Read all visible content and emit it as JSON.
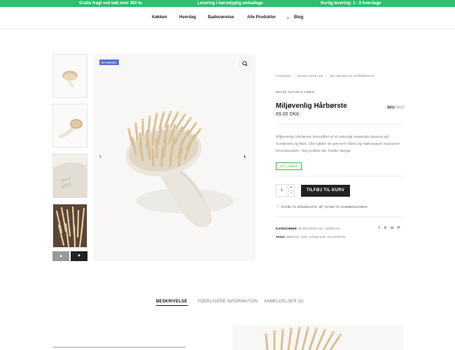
{
  "topbar": {
    "left": "Gratis fragt ved køb over 300 kr.",
    "center": "Levering i bæredygtig emballage",
    "right": "Hurtig levering: 1 - 3 hverdage"
  },
  "nav": {
    "items": [
      "Køkken",
      "Hverdag",
      "Badeværelse",
      "Alle Produkter",
      "Blog"
    ]
  },
  "product": {
    "badge": "NYHEDE!",
    "breadcrumb": [
      "FORSIDE",
      "BADEVÆRELSE",
      "MILJØVENLIG HÅRBØRSTE"
    ],
    "brand": "BETER NATURAL FIBER",
    "title": "Miljøvenlig Hårbørste",
    "sku_label": "SKU:",
    "sku_value": "5012",
    "price": "69,00 DKK",
    "description": "Miljøvenlig hårbørste fremstillet af et naturligt materiale baseret på hvedestrå og fibre. Den glider let gennem håret og træknopper masserer hovedbunden. Høj kvalitet der holder længe.",
    "stock": "PÅ LAGER",
    "quantity": "1",
    "qty_plus": "+",
    "qty_minus": "−",
    "add_to_cart": "TILFØJ TIL KURV",
    "wishlist": "TILFØJ TIL ØNSKELISTE",
    "compare": "TILFØJ TIL SAMMENLIGNING",
    "categories_label": "KATEGORIER:",
    "categories": "BADEVÆRELSE, HVERDAG",
    "tags_label": "TAGS:",
    "tags": "BØRSTE, HÅR, HÅRPLEJE, PLASTIKFRI"
  },
  "tabs": [
    "BESKRIVELSE",
    "YDERLIGERE INFORMATION",
    "ANMELDELSER (0)"
  ],
  "icons": {
    "zoom": "magnifier-icon",
    "prev": "chevron-left-icon",
    "next": "chevron-right-icon",
    "thumb_up": "chevron-up-icon",
    "thumb_down": "chevron-down-icon",
    "wishlist": "heart-icon",
    "compare": "shuffle-icon",
    "blog": "chevron-right-icon",
    "social": [
      "facebook-icon",
      "twitter-icon",
      "linkedin-icon",
      "pinterest-icon"
    ]
  },
  "colors": {
    "topbar": "#2fbf6e",
    "badge": "#5a6fd6",
    "stock": "#3bb54a",
    "button": "#222222"
  }
}
